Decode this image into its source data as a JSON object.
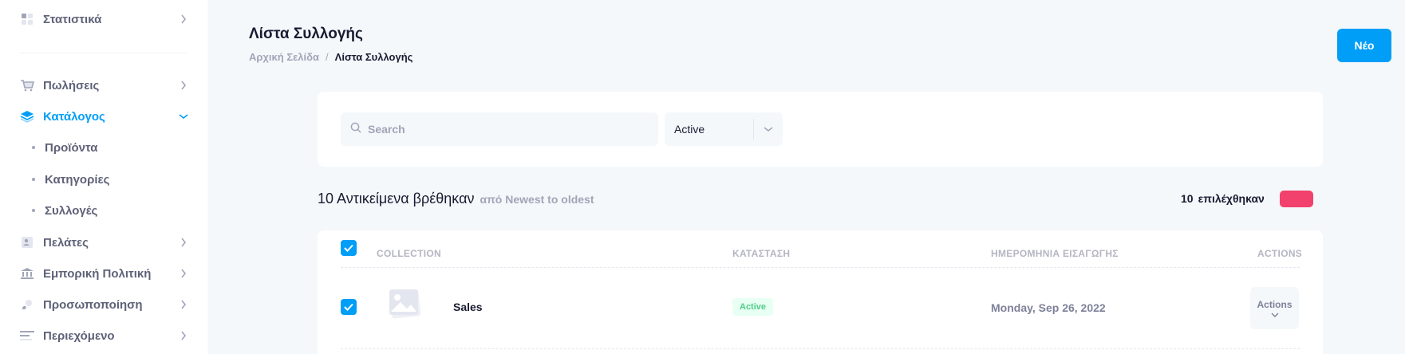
{
  "sidebar": {
    "stats": {
      "label": "Στατιστικά",
      "icon": "grid-icon"
    },
    "sales": {
      "label": "Πωλήσεις",
      "icon": "cart-icon"
    },
    "catalog": {
      "label": "Κατάλογος",
      "icon": "layers-icon"
    },
    "catalog_sub": [
      "Προϊόντα",
      "Κατηγορίες",
      "Συλλογές"
    ],
    "customers": {
      "label": "Πελάτες",
      "icon": "contacts-icon"
    },
    "pricing": {
      "label": "Εμπορική Πολιτική",
      "icon": "bank-icon"
    },
    "personalization": {
      "label": "Προσωποποίηση",
      "icon": "brush-icon"
    },
    "content": {
      "label": "Περιεχόμενο",
      "icon": "text-lines-icon"
    }
  },
  "header": {
    "title": "Λίστα Συλλογής",
    "breadcrumb_home": "Αρχική Σελίδα",
    "breadcrumb_sep": "/",
    "breadcrumb_current": "Λίστα Συλλογής",
    "new_button": "Νέο"
  },
  "filters": {
    "search_placeholder": "Search",
    "status_value": "Active"
  },
  "results": {
    "count_text": "10 Αντικείμενα βρέθηκαν",
    "sort_text": "από Newest to oldest",
    "selected_count": "10",
    "selected_label": "επιλέχθηκαν"
  },
  "table": {
    "headers": {
      "collection": "COLLECTION",
      "status": "ΚΑΤΑΣΤΑΣΗ",
      "date": "ΗΜΕΡΟΜΗΝΙΑ ΕΙΣΑΓΩΓΗΣ",
      "actions": "ACTIONS"
    },
    "rows": [
      {
        "name": "Sales",
        "status": "Active",
        "date": "Monday, Sep 26, 2022",
        "actions": "Actions"
      }
    ]
  },
  "colors": {
    "primary": "#009ef7",
    "danger": "#f1416c",
    "success": "#50cd89"
  }
}
